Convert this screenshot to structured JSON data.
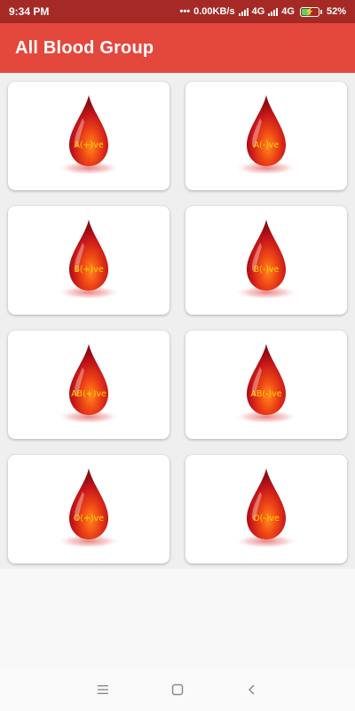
{
  "status_bar": {
    "time": "9:34 PM",
    "network_speed": "0.00KB/s",
    "net_type_1": "4G",
    "net_type_2": "4G",
    "battery": "52%",
    "colors": {
      "background": "#a52a26"
    }
  },
  "app_bar": {
    "title": "All Blood Group",
    "color": "#e4473c"
  },
  "blood_groups": [
    {
      "label": "A(+)ve"
    },
    {
      "label": "A(-)ve"
    },
    {
      "label": "B(+)ve"
    },
    {
      "label": "B(-)ve"
    },
    {
      "label": "AB(+)ve"
    },
    {
      "label": "AB(-)ve"
    },
    {
      "label": "O(+)ve"
    },
    {
      "label": "O(-)ve"
    }
  ],
  "nav_bar": {
    "icons": [
      "menu-icon",
      "home-icon",
      "back-icon"
    ]
  }
}
